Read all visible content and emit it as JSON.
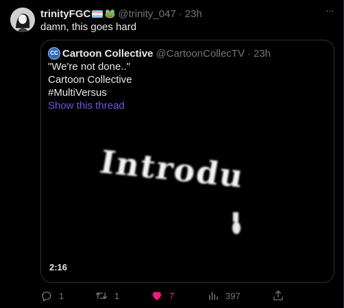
{
  "tweet": {
    "display_name": "trinityFGC",
    "handle": "@trinity_047",
    "separator": "·",
    "time": "23h",
    "text": "damn, this goes hard",
    "more_label": "···"
  },
  "quoted": {
    "avatar_text": "CC",
    "display_name": "Cartoon Collective",
    "handle": "@CartoonCollecTV",
    "separator": "·",
    "time": "23h",
    "lines": [
      "\"We're not done..\"",
      "Cartoon Collective",
      "#MultiVersus"
    ],
    "show_thread": "Show this thread",
    "video": {
      "overlay_text": "Introdu",
      "duration": "2:16"
    }
  },
  "actions": {
    "replies": "1",
    "retweets": "1",
    "likes": "7",
    "views": "397"
  },
  "colors": {
    "background": "#000000",
    "text": "#e7e9ea",
    "muted": "#71767b",
    "border": "#2f3336",
    "like": "#f91880",
    "link": "#6a5ae0"
  }
}
